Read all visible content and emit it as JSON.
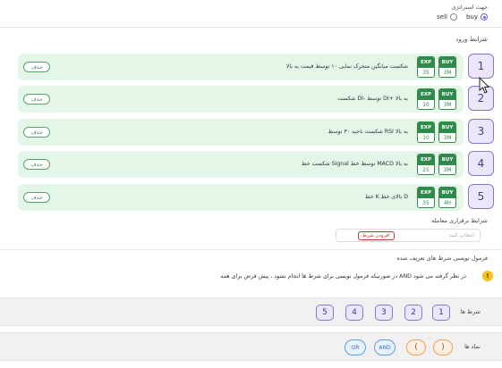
{
  "strategy": {
    "direction_title": "جهت استراتژی",
    "options": [
      {
        "label": "buy",
        "selected": true
      },
      {
        "label": "sell",
        "selected": false
      }
    ]
  },
  "entry": {
    "title": "شرایط ورود",
    "delete_label": "حذف",
    "rows": [
      {
        "num": "1",
        "text": "شکست میانگین متحرک نمایی ۱۰ توسط قیمت به بالا",
        "buy_label": "BUY",
        "buy_tf": "3M",
        "exp_label": "EXP",
        "exp_val": "35"
      },
      {
        "num": "2",
        "text": "شکست DI- توسط DI+ به بالا",
        "buy_label": "BUY",
        "buy_tf": "3M",
        "exp_label": "EXP",
        "exp_val": "10"
      },
      {
        "num": "3",
        "text": "شکست ناحیه ۳۰ توسط RSI به بالا",
        "buy_label": "BUY",
        "buy_tf": "3M",
        "exp_label": "EXP",
        "exp_val": "10"
      },
      {
        "num": "4",
        "text": "شکست خط Signal توسط خط MACD به بالا",
        "buy_label": "BUY",
        "buy_tf": "3M",
        "exp_label": "EXP",
        "exp_val": "25"
      },
      {
        "num": "5",
        "text": "خط K بالای خط D",
        "buy_label": "BUY",
        "buy_tf": "4H",
        "exp_label": "EXP",
        "exp_val": "35"
      }
    ]
  },
  "trade": {
    "title": "شرایط برقراری معامله",
    "placeholder": "انتخاب کنید",
    "add_label": "افزودن شرط"
  },
  "formula": {
    "title": "فرمول نویسی شرط های تعریف شده",
    "note_icon": "!",
    "note": "در صورتیکه فرمول نویسی برای شرط ها انجام نشود ، پیش فرض برای همه AND در نظر گرفته می شود",
    "conditions_label": "شرط ها",
    "conditions": [
      "1",
      "2",
      "3",
      "4",
      "5"
    ],
    "symbols_label": "نماد ها",
    "symbols": [
      "OR",
      "AND",
      "(",
      ")"
    ]
  },
  "colors": {
    "accent": "#8b74d6",
    "row_bg": "#e4f6e8",
    "badge_green": "#2f8a4c",
    "operator": "#5aa0e6",
    "paren": "#e9a05a"
  }
}
